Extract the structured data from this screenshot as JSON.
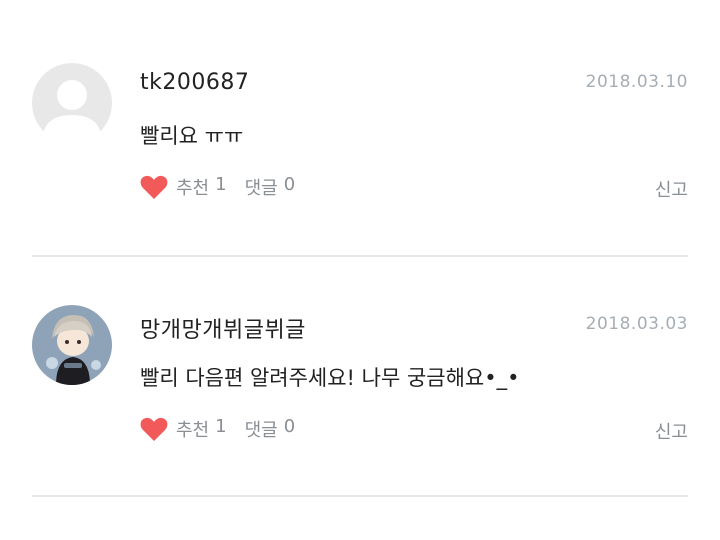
{
  "comments": [
    {
      "username": "tk200687",
      "date": "2018.03.10",
      "text": "빨리요 ㅠㅠ",
      "avatar": "default-avatar-icon",
      "like_label": "추천",
      "like_count": "1",
      "reply_label": "댓글",
      "reply_count": "0",
      "report_label": "신고"
    },
    {
      "username": "망개망개뷔글뷔글",
      "date": "2018.03.03",
      "text": "빨리 다음편 알려주세요! 나무 궁금해요•_•",
      "avatar": "character-avatar",
      "like_label": "추천",
      "like_count": "1",
      "reply_label": "댓글",
      "reply_count": "0",
      "report_label": "신고"
    }
  ],
  "colors": {
    "heart": "#f25a5a",
    "meta_text": "#a6aeb5",
    "divider": "#e5e9ec"
  }
}
